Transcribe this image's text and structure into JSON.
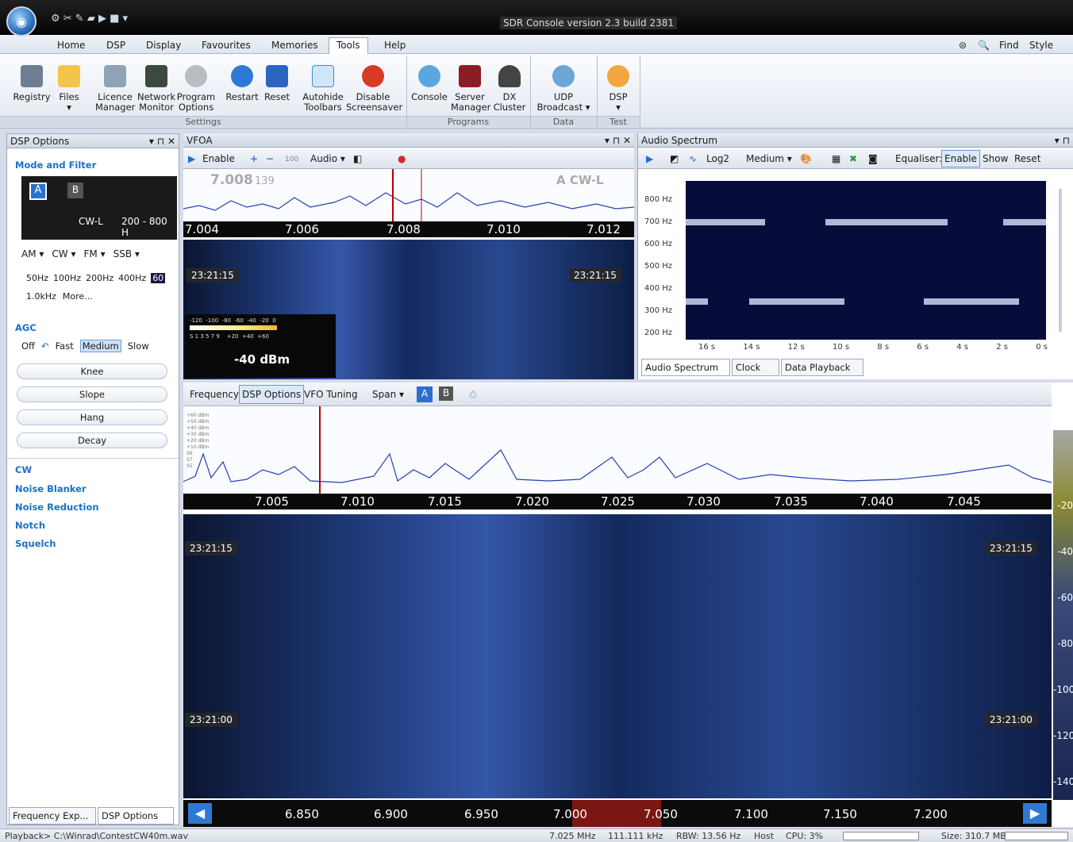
{
  "app": {
    "title": "SDR Console version 2.3 build 2381"
  },
  "menu": {
    "items": [
      "Home",
      "DSP",
      "Display",
      "Favourites",
      "Memories",
      "Tools",
      "Help"
    ],
    "find": "Find",
    "style": "Style"
  },
  "ribbon": {
    "buttons": [
      {
        "l1": "Registry",
        "l2": ""
      },
      {
        "l1": "Files",
        "l2": "▾"
      },
      {
        "l1": "Licence",
        "l2": "Manager"
      },
      {
        "l1": "Network",
        "l2": "Monitor"
      },
      {
        "l1": "Program",
        "l2": "Options"
      },
      {
        "l1": "Restart",
        "l2": ""
      },
      {
        "l1": "Reset",
        "l2": ""
      },
      {
        "l1": "Autohide",
        "l2": "Toolbars"
      },
      {
        "l1": "Disable",
        "l2": "Screensaver"
      },
      {
        "l1": "Console",
        "l2": ""
      },
      {
        "l1": "Server",
        "l2": "Manager"
      },
      {
        "l1": "DX",
        "l2": "Cluster"
      },
      {
        "l1": "UDP",
        "l2": "Broadcast ▾"
      },
      {
        "l1": "DSP",
        "l2": "▾"
      }
    ],
    "groups": [
      "Settings",
      "Programs",
      "Data",
      "Test"
    ]
  },
  "left": {
    "title": "DSP Options",
    "mode_filter": "Mode and Filter",
    "vfo_a": "A",
    "vfo_b": "B",
    "mode": "CW-L",
    "filter": "200 - 800 H",
    "modes": [
      "AM ▾",
      "CW ▾",
      "FM ▾",
      "SSB ▾"
    ],
    "bandwidths": [
      "50Hz",
      "100Hz",
      "200Hz",
      "400Hz",
      "60"
    ],
    "bw2": [
      "1.0kHz",
      "More..."
    ],
    "agc": "AGC",
    "agc_opts": [
      "Off",
      "Fast",
      "Medium",
      "Slow"
    ],
    "agc_sliders": [
      "Knee",
      "Slope",
      "Hang",
      "Decay"
    ],
    "sections": [
      "CW",
      "Noise Blanker",
      "Noise Reduction",
      "Notch",
      "Squelch"
    ],
    "tabs": [
      "Frequency Exp...",
      "DSP Options"
    ]
  },
  "vfo": {
    "title": "VFOA",
    "enable": "Enable",
    "step": "100",
    "audio": "Audio ▾",
    "freq_big": "7.008",
    "freq_small": "139",
    "mode_tag": "A CW-L",
    "ticks": [
      "7.004",
      "7.006",
      "7.008",
      "7.010",
      "7.012"
    ],
    "timestamp": "23:21:15",
    "meter_scale": "-120  -100  -80  -60  -40  -20  0",
    "meter_scale2": "S 1 3 5 7 9    +20  +40  +60",
    "signal": "-40 dBm"
  },
  "audio": {
    "title": "Audio Spectrum",
    "log": "Log2",
    "medium": "Medium ▾",
    "equaliser": "Equaliser:",
    "enable": "Enable",
    "show": "Show",
    "reset": "Reset",
    "yticks": [
      "800 Hz",
      "700 Hz",
      "600 Hz",
      "500 Hz",
      "400 Hz",
      "300 Hz",
      "200 Hz"
    ],
    "xticks": [
      "16 s",
      "14 s",
      "12 s",
      "10 s",
      "8 s",
      "6 s",
      "4 s",
      "2 s",
      "0 s"
    ],
    "tabs": [
      "Audio Spectrum",
      "Clock",
      "Data Playback"
    ]
  },
  "main": {
    "tabs": [
      "Frequency",
      "DSP Options",
      "VFO Tuning"
    ],
    "span": "Span ▾",
    "a": "A",
    "b": "B",
    "ticks": [
      "7.005",
      "7.010",
      "7.015",
      "7.020",
      "7.025",
      "7.030",
      "7.035",
      "7.040",
      "7.045"
    ],
    "dbm": [
      "+60 dBm",
      "+50 dBm",
      "+40 dBm",
      "+30 dBm",
      "+20 dBm",
      "+10 dBm",
      "S9",
      "S7",
      "S5"
    ],
    "ts1": "23:21:15",
    "ts2": "23:21:00",
    "band_ticks": [
      "6.850",
      "6.900",
      "6.950",
      "7.000",
      "7.050",
      "7.100",
      "7.150",
      "7.200"
    ],
    "right_scale": [
      "-20",
      "-40",
      "-60",
      "-80",
      "-100",
      "-120",
      "-140"
    ]
  },
  "status": {
    "left": "Playback> C:\\Winrad\\ContestCW40m.wav",
    "freq": "7.025 MHz",
    "bw": "111.111 kHz",
    "rbw": "RBW: 13.56 Hz",
    "host": "Host",
    "cpu": "CPU: 3%",
    "size": "Size: 310.7 MB"
  }
}
